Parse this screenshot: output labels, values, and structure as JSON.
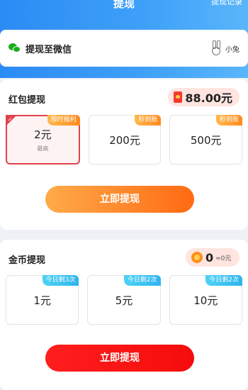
{
  "nav": {
    "title": "提现",
    "right_link": "提现记录"
  },
  "wechat": {
    "label": "提现至微信",
    "username": "小兔"
  },
  "red_packet": {
    "title": "红包提现",
    "amount": "88.00元",
    "options": [
      {
        "value": "2元",
        "sub": "最高",
        "tag": "限时福利",
        "selected": true
      },
      {
        "value": "200元",
        "tag": "秒到账"
      },
      {
        "value": "500元",
        "tag": "秒到账"
      }
    ],
    "button": "立即提现"
  },
  "coins": {
    "title": "金币提现",
    "amount": "0",
    "equiv": "≈0元",
    "options": [
      {
        "value": "1元",
        "tag": "今日剩3次"
      },
      {
        "value": "5元",
        "tag": "今日剩2次"
      },
      {
        "value": "10元",
        "tag": "今日剩2次"
      }
    ],
    "button": "立即提现"
  },
  "colors": {
    "header": "#3fa1f8",
    "accent_red": "#e0434c",
    "orange": "#ff8a1c",
    "blue_tag": "#2eb4ee"
  }
}
